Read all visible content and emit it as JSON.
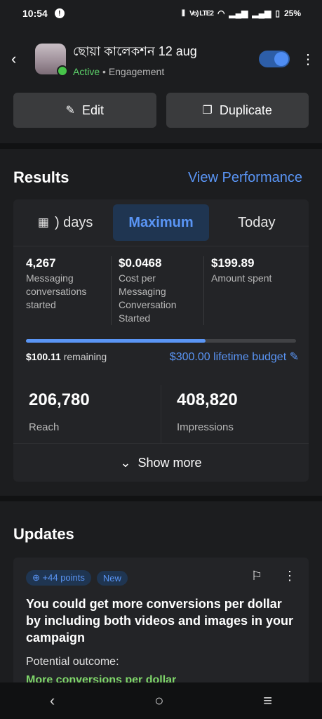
{
  "status": {
    "time": "10:54",
    "network": "Vo) LTE2",
    "battery": "25%"
  },
  "header": {
    "campaign_name": "ছোয়া কালেকশন 12 aug",
    "status_label": "Active",
    "separator": "•",
    "objective": "Engagement"
  },
  "actions": {
    "edit_label": "Edit",
    "duplicate_label": "Duplicate"
  },
  "results": {
    "title": "Results",
    "view_performance": "View Performance",
    "tabs": [
      {
        "label": ") days"
      },
      {
        "label": "Maximum"
      },
      {
        "label": "Today"
      }
    ],
    "metrics": [
      {
        "value": "4,267",
        "label": "Messaging conversations started"
      },
      {
        "value": "$0.0468",
        "label": "Cost per Messaging Conversation Started"
      },
      {
        "value": "$199.89",
        "label": "Amount spent"
      }
    ],
    "budget": {
      "progress_fraction": 0.665,
      "remaining_amount": "$100.11",
      "remaining_suffix": "remaining",
      "lifetime_budget": "$300.00 lifetime budget"
    },
    "reach": {
      "value": "206,780",
      "label": "Reach"
    },
    "impressions": {
      "value": "408,820",
      "label": "Impressions"
    },
    "show_more": "Show more"
  },
  "updates": {
    "title": "Updates",
    "card": {
      "points_chip": "+44 points",
      "new_chip": "New",
      "text": "You could get more conversions per dollar by including both videos and images in your campaign",
      "outcome_label": "Potential outcome:",
      "outcome_value": "More conversions per dollar"
    }
  },
  "colors": {
    "accent": "#5a95f5",
    "active": "#5dd36b",
    "outcome": "#7fd66a"
  }
}
